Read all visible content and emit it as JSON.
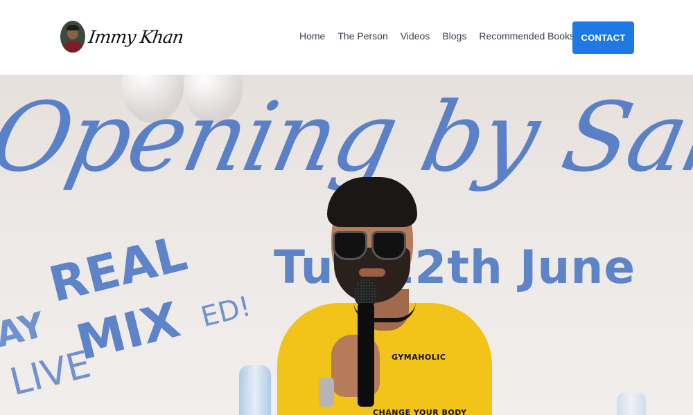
{
  "header": {
    "logo_text": "Immy Khan",
    "nav": [
      {
        "label": "Home"
      },
      {
        "label": "The Person"
      },
      {
        "label": "Videos"
      },
      {
        "label": "Blogs"
      },
      {
        "label": "Recommended Books"
      }
    ],
    "contact_label": "CONTACT"
  },
  "hero": {
    "banner_script": "Opening by SahilK",
    "banner_date": "Tue 12th June",
    "banner_real": "REAL",
    "banner_mix": "MIX",
    "banner_ed": "ED!",
    "banner_live": "LIVE",
    "banner_ay": "AY",
    "shirt_logo": "GYMAHOLIC",
    "shirt_text": "CHANGE YOUR BODY"
  },
  "colors": {
    "accent": "#1e79e4",
    "banner_blue": "#4e78c6",
    "shirt_yellow": "#f2c318"
  },
  "icons": {
    "avatar": "profile-photo"
  }
}
